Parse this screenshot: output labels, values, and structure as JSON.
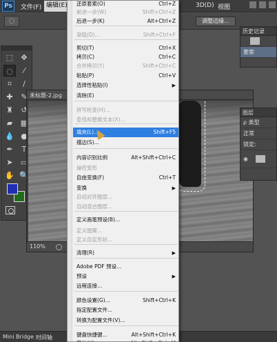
{
  "app": {
    "logo": "Ps"
  },
  "menubar": {
    "items": [
      {
        "label": "文件(F)"
      },
      {
        "label": "编辑(E)"
      },
      {
        "label": "3D(D)"
      },
      {
        "label": "视图"
      }
    ]
  },
  "options_bar": {
    "refine_label": "调整边缘..."
  },
  "document": {
    "tab_label": "未标题-2.jpg",
    "zoom": "110%"
  },
  "right_panels": {
    "history_tab": "历史记录",
    "history_state": "套索",
    "layers_tab": "图层",
    "kind_filter": "ρ 类型",
    "blend_mode": "正常",
    "lock_label": "锁定:"
  },
  "bottom_tabs": [
    "Mini Bridge",
    "时间轴"
  ],
  "edit_menu": {
    "items": [
      {
        "label": "还原套索(O)",
        "shortcut": "Ctrl+Z",
        "disabled": false
      },
      {
        "label": "前进一步(W)",
        "shortcut": "Shift+Ctrl+Z",
        "disabled": true
      },
      {
        "label": "后退一步(K)",
        "shortcut": "Alt+Ctrl+Z",
        "disabled": false
      },
      {
        "label": "渐隐(D)...",
        "shortcut": "Shift+Ctrl+F",
        "disabled": true
      },
      {
        "label": "剪切(T)",
        "shortcut": "Ctrl+X",
        "disabled": false
      },
      {
        "label": "拷贝(C)",
        "shortcut": "Ctrl+C",
        "disabled": false
      },
      {
        "label": "合并拷贝(Y)",
        "shortcut": "Shift+Ctrl+C",
        "disabled": true
      },
      {
        "label": "粘贴(P)",
        "shortcut": "Ctrl+V",
        "disabled": false
      },
      {
        "label": "选择性粘贴(I)",
        "shortcut": "",
        "submenu": true,
        "disabled": false
      },
      {
        "label": "清除(E)",
        "shortcut": "",
        "disabled": false
      },
      {
        "label": "拼写检查(H)...",
        "shortcut": "",
        "disabled": true
      },
      {
        "label": "查找和替换文本(X)...",
        "shortcut": "",
        "disabled": true
      },
      {
        "label": "填充(L)...",
        "shortcut": "Shift+F5",
        "disabled": false,
        "highlighted": true
      },
      {
        "label": "描边(S)...",
        "shortcut": "",
        "disabled": false
      },
      {
        "label": "内容识别比例",
        "shortcut": "Alt+Shift+Ctrl+C",
        "disabled": false
      },
      {
        "label": "操控变形",
        "shortcut": "",
        "disabled": true
      },
      {
        "label": "自由变换(F)",
        "shortcut": "Ctrl+T",
        "disabled": false
      },
      {
        "label": "变换",
        "shortcut": "",
        "submenu": true,
        "disabled": false
      },
      {
        "label": "自动对齐图层...",
        "shortcut": "",
        "disabled": true
      },
      {
        "label": "自动混合图层...",
        "shortcut": "",
        "disabled": true
      },
      {
        "label": "定义画笔预设(B)...",
        "shortcut": "",
        "disabled": false
      },
      {
        "label": "定义图案...",
        "shortcut": "",
        "disabled": true
      },
      {
        "label": "定义自定形状...",
        "shortcut": "",
        "disabled": true
      },
      {
        "label": "清理(R)",
        "shortcut": "",
        "submenu": true,
        "disabled": false
      },
      {
        "label": "Adobe PDF 预设...",
        "shortcut": "",
        "disabled": false
      },
      {
        "label": "预设",
        "shortcut": "",
        "submenu": true,
        "disabled": false
      },
      {
        "label": "远程连接...",
        "shortcut": "",
        "disabled": false
      },
      {
        "label": "颜色设置(G)...",
        "shortcut": "Shift+Ctrl+K",
        "disabled": false
      },
      {
        "label": "指定配置文件...",
        "shortcut": "",
        "disabled": false
      },
      {
        "label": "转换为配置文件(V)...",
        "shortcut": "",
        "disabled": false
      },
      {
        "label": "键盘快捷键...",
        "shortcut": "Alt+Shift+Ctrl+K",
        "disabled": false
      },
      {
        "label": "菜单(U)...",
        "shortcut": "Alt+Shift+Ctrl+M",
        "disabled": false
      }
    ]
  },
  "colors": {
    "foreground": "#1f2fb4",
    "background": "#1f6b1a",
    "menu_highlight": "#2f7fe0"
  }
}
